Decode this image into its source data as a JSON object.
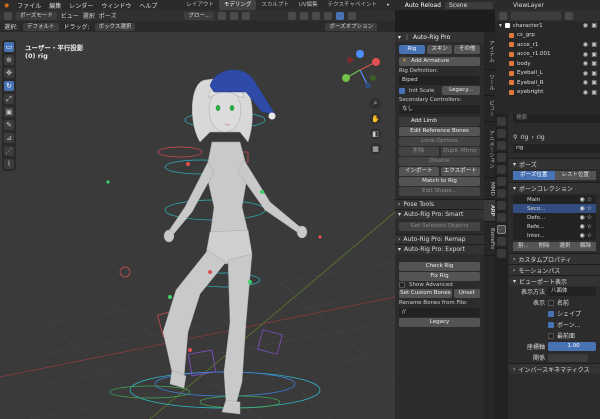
{
  "menu": [
    "ファイル",
    "編集",
    "レンダー",
    "ウィンドウ",
    "ヘルプ"
  ],
  "workspaces": [
    "レイアウト",
    "モデリング",
    "スカルプト",
    "UV編集",
    "テクスチャペイント"
  ],
  "workspace_active": "モデリング",
  "top_right": {
    "auto_reload": "Auto Reload",
    "scene": "Scene",
    "view_layer": "ViewLayer"
  },
  "viewport_header": {
    "mode": "ポーズモード",
    "view": "ビュー",
    "select": "選択",
    "pose": "ポーズ",
    "orientation": "グロー...",
    "pose_options": "ポーズオプション"
  },
  "viewport_header2": {
    "select_label": "選択:",
    "default": "デフォルト",
    "drag": "ドラッグ:",
    "box_select": "ボックス選択"
  },
  "viewport_overlay": {
    "line1": "ユーザー・平行投影",
    "line2": "(0) rig"
  },
  "toolbar_icons": [
    "cursor-icon",
    "move-icon",
    "rotate-icon",
    "scale-icon",
    "transform-icon",
    "annotate-icon",
    "measure-icon",
    "pose-breakdown-icon",
    "relax-icon"
  ],
  "n_tabs": [
    "アイテム",
    "ツール",
    "ビュー",
    "アニメーション",
    "MMD",
    "ARP",
    "BoneFix"
  ],
  "n_tab_active": "ARP",
  "autorig": {
    "title": "Auto-Rig Pro",
    "tabs": [
      "Rig",
      "スキン",
      "その他"
    ],
    "tab_active": "Rig",
    "add_armature": "Add Armature",
    "rig_definition_label": "Rig Definition:",
    "rig_definition": "Biped",
    "init_scale": "Init Scale",
    "legacy": "Legacy...",
    "secondary_controllers_label": "Secondary Controllers:",
    "secondary_controllers": "なし",
    "add_limb": "Add Limb",
    "edit_reference_bones": "Edit Reference Bones",
    "limb_options": "Limb Options",
    "delete": "削除",
    "dupli_mirror": "Dupli. Mirror",
    "disable": "Disable",
    "import": "インポート",
    "export": "エクスポート",
    "match_to_rig": "Match to Rig",
    "edit_shape": "Edit Shape...",
    "pose_tools": "Pose Tools",
    "smart_title": "Auto-Rig Pro: Smart",
    "get_selected_objects": "Get Selected Objects",
    "remap_title": "Auto-Rig Pro: Remap",
    "export_title": "Auto-Rig Pro: Export",
    "check_rig": "Check Rig",
    "fix_rig": "Fix Rig",
    "show_advanced": "Show Advanced",
    "set_custom_bones": "Set Custom Bones",
    "unset": "Unset",
    "rename_bones_label": "Rename Bones from File:",
    "rename_path": "//",
    "legacy2": "Legacy"
  },
  "outliner": {
    "items": [
      {
        "name": "character1",
        "indent": 0
      },
      {
        "name": "cs_grp",
        "indent": 1
      },
      {
        "name": "acce_r1",
        "indent": 1
      },
      {
        "name": "acce_r1.001",
        "indent": 1
      },
      {
        "name": "body",
        "indent": 1
      },
      {
        "name": "Eyeball_L",
        "indent": 1
      },
      {
        "name": "Eyeball_R",
        "indent": 1
      },
      {
        "name": "eyebright",
        "indent": 1
      }
    ]
  },
  "properties": {
    "search_placeholder": "検索",
    "breadcrumb_a": "rig",
    "breadcrumb_b": "rig",
    "object_name": "rig",
    "pose_section": "ポーズ",
    "pose_position": "ポーズ位置",
    "rest_position": "レスト位置",
    "bone_collections": "ボーンコレクション",
    "collections": [
      "Main",
      "Seco...",
      "Defo...",
      "Refe...",
      "Inter..."
    ],
    "collections_selected": "Seco...",
    "assign": "割...",
    "delete": "削除",
    "select": "選択",
    "deselect": "解除",
    "custom_props": "カスタムプロパティ",
    "motion_paths": "モーションパス",
    "viewport_display": "ビューポート表示",
    "display_as_label": "表示方法",
    "display_as": "八面体",
    "show_label": "表示",
    "name_label": "名前",
    "shape_label": "シェイプ",
    "bone_label": "ボーン...",
    "front_label": "最前面",
    "relation_label": "座標軸",
    "relation_value": "1.00",
    "wire_label": "関係",
    "inverse_kinematics": "インバースキネマティクス"
  }
}
